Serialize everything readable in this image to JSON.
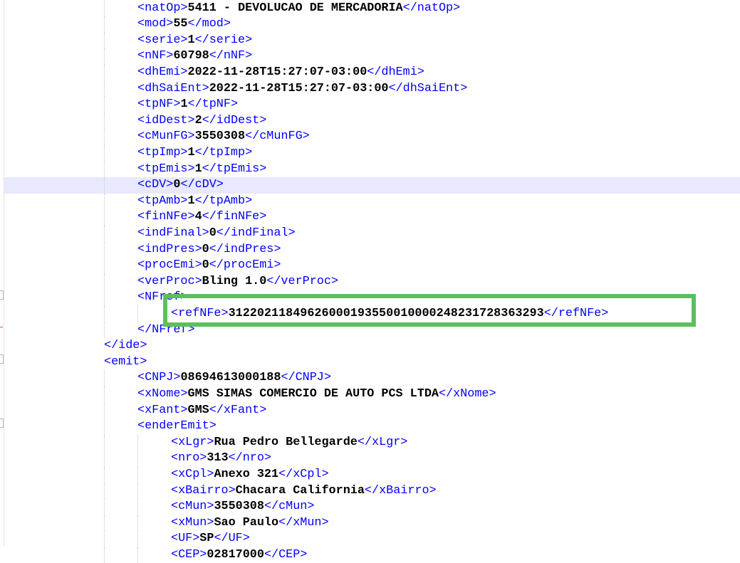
{
  "lines": [
    {
      "indent": 2,
      "tag": "natOp",
      "value": "5411 - DEVOLUCAO DE MERCADORIA"
    },
    {
      "indent": 2,
      "tag": "mod",
      "value": "55"
    },
    {
      "indent": 2,
      "tag": "serie",
      "value": "1"
    },
    {
      "indent": 2,
      "tag": "nNF",
      "value": "60798"
    },
    {
      "indent": 2,
      "tag": "dhEmi",
      "value": "2022-11-28T15:27:07-03:00"
    },
    {
      "indent": 2,
      "tag": "dhSaiEnt",
      "value": "2022-11-28T15:27:07-03:00"
    },
    {
      "indent": 2,
      "tag": "tpNF",
      "value": "1"
    },
    {
      "indent": 2,
      "tag": "idDest",
      "value": "2"
    },
    {
      "indent": 2,
      "tag": "cMunFG",
      "value": "3550308"
    },
    {
      "indent": 2,
      "tag": "tpImp",
      "value": "1"
    },
    {
      "indent": 2,
      "tag": "tpEmis",
      "value": "1"
    },
    {
      "indent": 2,
      "tag": "cDV",
      "value": "0",
      "current": true
    },
    {
      "indent": 2,
      "tag": "tpAmb",
      "value": "1"
    },
    {
      "indent": 2,
      "tag": "finNFe",
      "value": "4"
    },
    {
      "indent": 2,
      "tag": "indFinal",
      "value": "0"
    },
    {
      "indent": 2,
      "tag": "indPres",
      "value": "0"
    },
    {
      "indent": 2,
      "tag": "procEmi",
      "value": "0"
    },
    {
      "indent": 2,
      "tag": "verProc",
      "value": "Bling 1.0"
    },
    {
      "indent": 2,
      "open": "NFref"
    },
    {
      "indent": 3,
      "tag": "refNFe",
      "value": "31220211849626000193550010000248231728363293"
    },
    {
      "indent": 2,
      "close": "NFref"
    },
    {
      "indent": 1,
      "close": "ide"
    },
    {
      "indent": 1,
      "open": "emit"
    },
    {
      "indent": 2,
      "tag": "CNPJ",
      "value": "08694613000188"
    },
    {
      "indent": 2,
      "tag": "xNome",
      "value": "GMS SIMAS COMERCIO DE AUTO PCS LTDA"
    },
    {
      "indent": 2,
      "tag": "xFant",
      "value": "GMS"
    },
    {
      "indent": 2,
      "open": "enderEmit"
    },
    {
      "indent": 3,
      "tag": "xLgr",
      "value": "Rua Pedro Bellegarde"
    },
    {
      "indent": 3,
      "tag": "nro",
      "value": "313"
    },
    {
      "indent": 3,
      "tag": "xCpl",
      "value": "Anexo 321"
    },
    {
      "indent": 3,
      "tag": "xBairro",
      "value": "Chacara California"
    },
    {
      "indent": 3,
      "tag": "cMun",
      "value": "3550308"
    },
    {
      "indent": 3,
      "tag": "xMun",
      "value": "Sao Paulo"
    },
    {
      "indent": 3,
      "tag": "UF",
      "value": "SP"
    },
    {
      "indent": 3,
      "tag": "CEP",
      "value": "02817000"
    }
  ],
  "highlight": {
    "target_tag": "refNFe",
    "color": "#5cbf5c"
  },
  "colors": {
    "tag": "#0000ff",
    "value": "#000000",
    "current_line": "#e8e8ff"
  }
}
